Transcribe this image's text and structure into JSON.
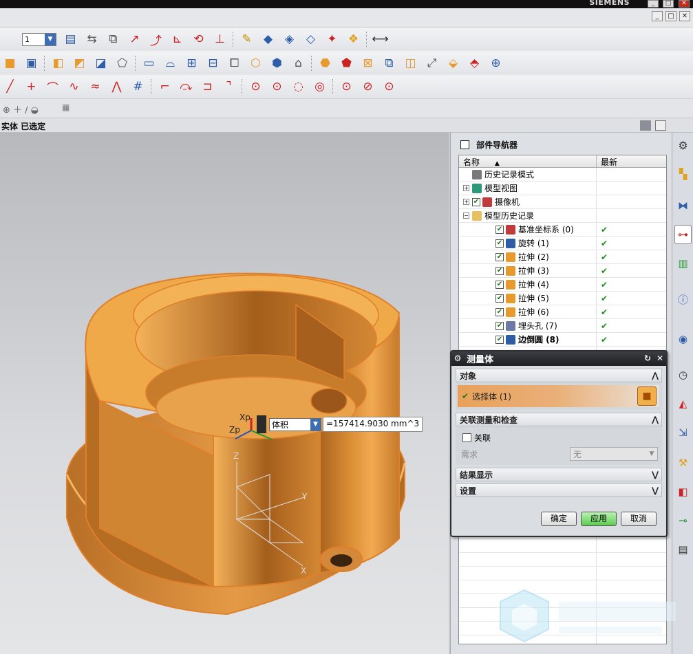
{
  "app": {
    "brand": "SIEMENS",
    "window_buttons": [
      "_",
      "□",
      "✕"
    ],
    "mdi_buttons": [
      "_",
      "□",
      "✕"
    ]
  },
  "toolbar": {
    "layer_value": "1"
  },
  "status": {
    "text": "实体 已选定"
  },
  "part_navigator": {
    "title": "部件导航器",
    "columns": [
      "名称",
      "最新"
    ],
    "items": [
      {
        "label": "历史记录模式",
        "icon": "clock-icon",
        "level": 0,
        "checked": null,
        "expander": "",
        "newest": ""
      },
      {
        "label": "模型视图",
        "icon": "cube-view-icon",
        "level": 0,
        "checked": null,
        "expander": "+",
        "newest": ""
      },
      {
        "label": "摄像机",
        "icon": "camera-icon",
        "level": 0,
        "checked": true,
        "expander": "+",
        "newest": ""
      },
      {
        "label": "模型历史记录",
        "icon": "folder-icon",
        "level": 0,
        "checked": null,
        "expander": "−",
        "newest": ""
      },
      {
        "label": "基准坐标系 (0)",
        "icon": "datum-csys-icon",
        "level": 1,
        "checked": true,
        "expander": "",
        "newest": "✔"
      },
      {
        "label": "旋转 (1)",
        "icon": "revolve-icon",
        "level": 1,
        "checked": true,
        "expander": "",
        "newest": "✔"
      },
      {
        "label": "拉伸 (2)",
        "icon": "extrude-icon",
        "level": 1,
        "checked": true,
        "expander": "",
        "newest": "✔"
      },
      {
        "label": "拉伸 (3)",
        "icon": "extrude-icon",
        "level": 1,
        "checked": true,
        "expander": "",
        "newest": "✔"
      },
      {
        "label": "拉伸 (4)",
        "icon": "extrude-icon",
        "level": 1,
        "checked": true,
        "expander": "",
        "newest": "✔"
      },
      {
        "label": "拉伸 (5)",
        "icon": "extrude-icon",
        "level": 1,
        "checked": true,
        "expander": "",
        "newest": "✔"
      },
      {
        "label": "拉伸 (6)",
        "icon": "extrude-icon",
        "level": 1,
        "checked": true,
        "expander": "",
        "newest": "✔"
      },
      {
        "label": "埋头孔 (7)",
        "icon": "countersink-hole-icon",
        "level": 1,
        "checked": true,
        "expander": "",
        "newest": "✔"
      },
      {
        "label": "边倒圆 (8)",
        "icon": "edge-blend-icon",
        "level": 1,
        "checked": true,
        "expander": "",
        "newest": "✔",
        "bold": true
      }
    ]
  },
  "measure_dialog": {
    "title": "测量体",
    "section_object": "对象",
    "select_body_label": "选择体 (1)",
    "section_associative": "关联测量和检查",
    "associative_label": "关联",
    "requirement_label": "需求",
    "requirement_value": "无",
    "section_results": "结果显示",
    "section_settings": "设置",
    "ok_label": "确定",
    "apply_label": "应用",
    "cancel_label": "取消"
  },
  "measure_readout": {
    "property_value": "体积",
    "result_text": "=157414.9030 mm^3"
  },
  "axes": {
    "xp": "Xp",
    "zp": "Zp",
    "z": "Z",
    "y": "Y",
    "x": "X"
  },
  "colors": {
    "part_fill": "#f0a948",
    "part_shadow": "#b96f22",
    "part_edge": "#e07f2a",
    "apply_button": "#5ecb52",
    "check_green": "#1c8f1c"
  }
}
